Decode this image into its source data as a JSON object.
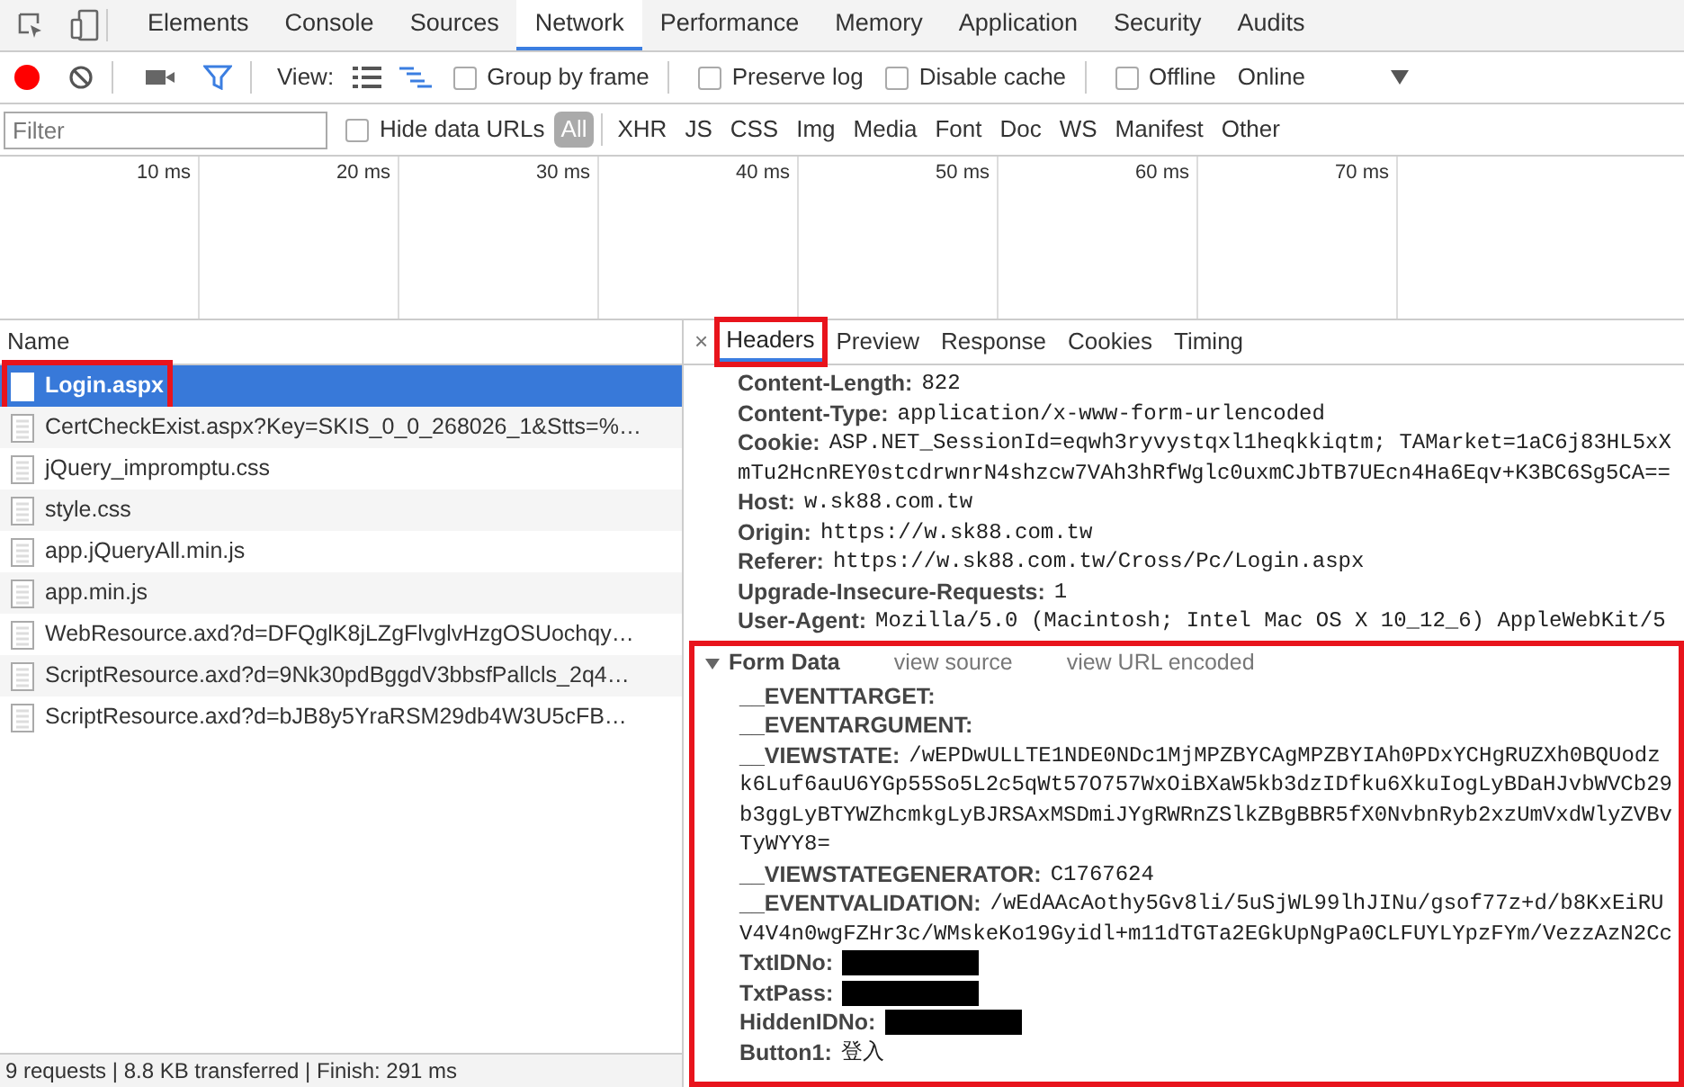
{
  "main_tabs": [
    {
      "label": "Elements",
      "selected": false
    },
    {
      "label": "Console",
      "selected": false
    },
    {
      "label": "Sources",
      "selected": false
    },
    {
      "label": "Network",
      "selected": true
    },
    {
      "label": "Performance",
      "selected": false
    },
    {
      "label": "Memory",
      "selected": false
    },
    {
      "label": "Application",
      "selected": false
    },
    {
      "label": "Security",
      "selected": false
    },
    {
      "label": "Audits",
      "selected": false
    }
  ],
  "toolbar": {
    "recording": true,
    "filter_active": true,
    "view_label": "View:",
    "large_rows": false,
    "waterfall": true,
    "checkboxes": [
      {
        "label": "Group by frame",
        "checked": false
      },
      {
        "label": "Preserve log",
        "checked": false
      },
      {
        "label": "Disable cache",
        "checked": false
      },
      {
        "label": "Offline",
        "checked": false
      }
    ],
    "throttling": "Online"
  },
  "filter_bar": {
    "placeholder": "Filter",
    "hide_data_urls": {
      "label": "Hide data URLs",
      "checked": false
    },
    "types": [
      {
        "label": "All",
        "selected": true
      },
      {
        "label": "XHR",
        "selected": false
      },
      {
        "label": "JS",
        "selected": false
      },
      {
        "label": "CSS",
        "selected": false
      },
      {
        "label": "Img",
        "selected": false
      },
      {
        "label": "Media",
        "selected": false
      },
      {
        "label": "Font",
        "selected": false
      },
      {
        "label": "Doc",
        "selected": false
      },
      {
        "label": "WS",
        "selected": false
      },
      {
        "label": "Manifest",
        "selected": false
      },
      {
        "label": "Other",
        "selected": false
      }
    ]
  },
  "timeline": {
    "ticks": [
      "10 ms",
      "20 ms",
      "30 ms",
      "40 ms",
      "50 ms",
      "60 ms",
      "70 ms"
    ]
  },
  "requests": {
    "column": "Name",
    "rows": [
      {
        "name": "Login.aspx",
        "selected": true,
        "highlighted": true
      },
      {
        "name": "CertCheckExist.aspx?Key=SKIS_0_0_268026_1&Stts=%…",
        "selected": false,
        "highlighted": false
      },
      {
        "name": "jQuery_impromptu.css",
        "selected": false,
        "highlighted": false
      },
      {
        "name": "style.css",
        "selected": false,
        "highlighted": false
      },
      {
        "name": "app.jQueryAll.min.js",
        "selected": false,
        "highlighted": false
      },
      {
        "name": "app.min.js",
        "selected": false,
        "highlighted": false
      },
      {
        "name": "WebResource.axd?d=DFQglK8jLZgFlvglvHzgOSUochqy…",
        "selected": false,
        "highlighted": false
      },
      {
        "name": "ScriptResource.axd?d=9Nk30pdBggdV3bbsfPallcls_2q4…",
        "selected": false,
        "highlighted": false
      },
      {
        "name": "ScriptResource.axd?d=bJB8y5YraRSM29db4W3U5cFB…",
        "selected": false,
        "highlighted": false
      }
    ]
  },
  "details": {
    "close": "×",
    "tabs": [
      {
        "label": "Headers",
        "selected": true,
        "highlighted": true
      },
      {
        "label": "Preview",
        "selected": false,
        "highlighted": false
      },
      {
        "label": "Response",
        "selected": false,
        "highlighted": false
      },
      {
        "label": "Cookies",
        "selected": false,
        "highlighted": false
      },
      {
        "label": "Timing",
        "selected": false,
        "highlighted": false
      }
    ],
    "headers": [
      {
        "name": "Content-Length:",
        "lines": [
          "822"
        ]
      },
      {
        "name": "Content-Type:",
        "lines": [
          "application/x-www-form-urlencoded"
        ]
      },
      {
        "name": "Cookie:",
        "lines": [
          "ASP.NET_SessionId=eqwh3ryvystqxl1heqkkiqtm; TAMarket=1aC6j83HL5xX",
          "mTu2HcnREY0stcdrwnrN4shzcw7VAh3hRfWglc0uxmCJbTB7UEcn4Ha6Eqv+K3BC6Sg5CA=="
        ]
      },
      {
        "name": "Host:",
        "lines": [
          "w.sk88.com.tw"
        ]
      },
      {
        "name": "Origin:",
        "lines": [
          "https://w.sk88.com.tw"
        ]
      },
      {
        "name": "Referer:",
        "lines": [
          "https://w.sk88.com.tw/Cross/Pc/Login.aspx"
        ]
      },
      {
        "name": "Upgrade-Insecure-Requests:",
        "lines": [
          "1"
        ]
      },
      {
        "name": "User-Agent:",
        "lines": [
          "Mozilla/5.0 (Macintosh; Intel Mac OS X 10_12_6) AppleWebKit/5"
        ]
      }
    ],
    "form_data": {
      "title": "Form Data",
      "expanded": true,
      "highlighted": true,
      "view_source": "view source",
      "view_encoded": "view URL encoded",
      "fields": [
        {
          "name": "__EVENTTARGET:",
          "redacted": false
        },
        {
          "name": "__EVENTARGUMENT:",
          "redacted": false
        },
        {
          "name": "__VIEWSTATE:",
          "lines": [
            "/wEPDwULLTE1NDE0NDc1MjMPZBYCAgMPZBYIAh0PDxYCHgRUZXh0BQUodz",
            "k6Luf6auU6YGp55So5L2c5qWt57O757WxOiBXaW5kb3dzIDfku6XkuIogLyBDaHJvbWVCb29",
            "b3ggLyBTYWZhcmkgLyBJRSAxMSDmiJYgRWRnZSlkZBgBBR5fX0NvbnRyb2xzUmVxdWlyZVBv",
            "TyWYY8="
          ],
          "redacted": false
        },
        {
          "name": "__VIEWSTATEGENERATOR:",
          "lines": [
            "C1767624"
          ],
          "redacted": false
        },
        {
          "name": "__EVENTVALIDATION:",
          "lines": [
            "/wEdAAcAothy5Gv8li/5uSjWL99lhJINu/gsof77z+d/b8KxEiRU",
            "V4V4n0wgFZHr3c/WMskeKo19Gyidl+m11dTGTa2EGkUpNgPa0CLFUYLYpzFYm/VezzAzN2Cc"
          ],
          "redacted": false
        },
        {
          "name": "TxtIDNo:",
          "redacted": true
        },
        {
          "name": "TxtPass:",
          "redacted": true
        },
        {
          "name": "HiddenIDNo:",
          "redacted": true
        },
        {
          "name": "Button1:",
          "lines": [
            "登入"
          ],
          "redacted": false
        }
      ]
    }
  },
  "status_bar": "9 requests | 8.8 KB transferred | Finish: 291 ms"
}
